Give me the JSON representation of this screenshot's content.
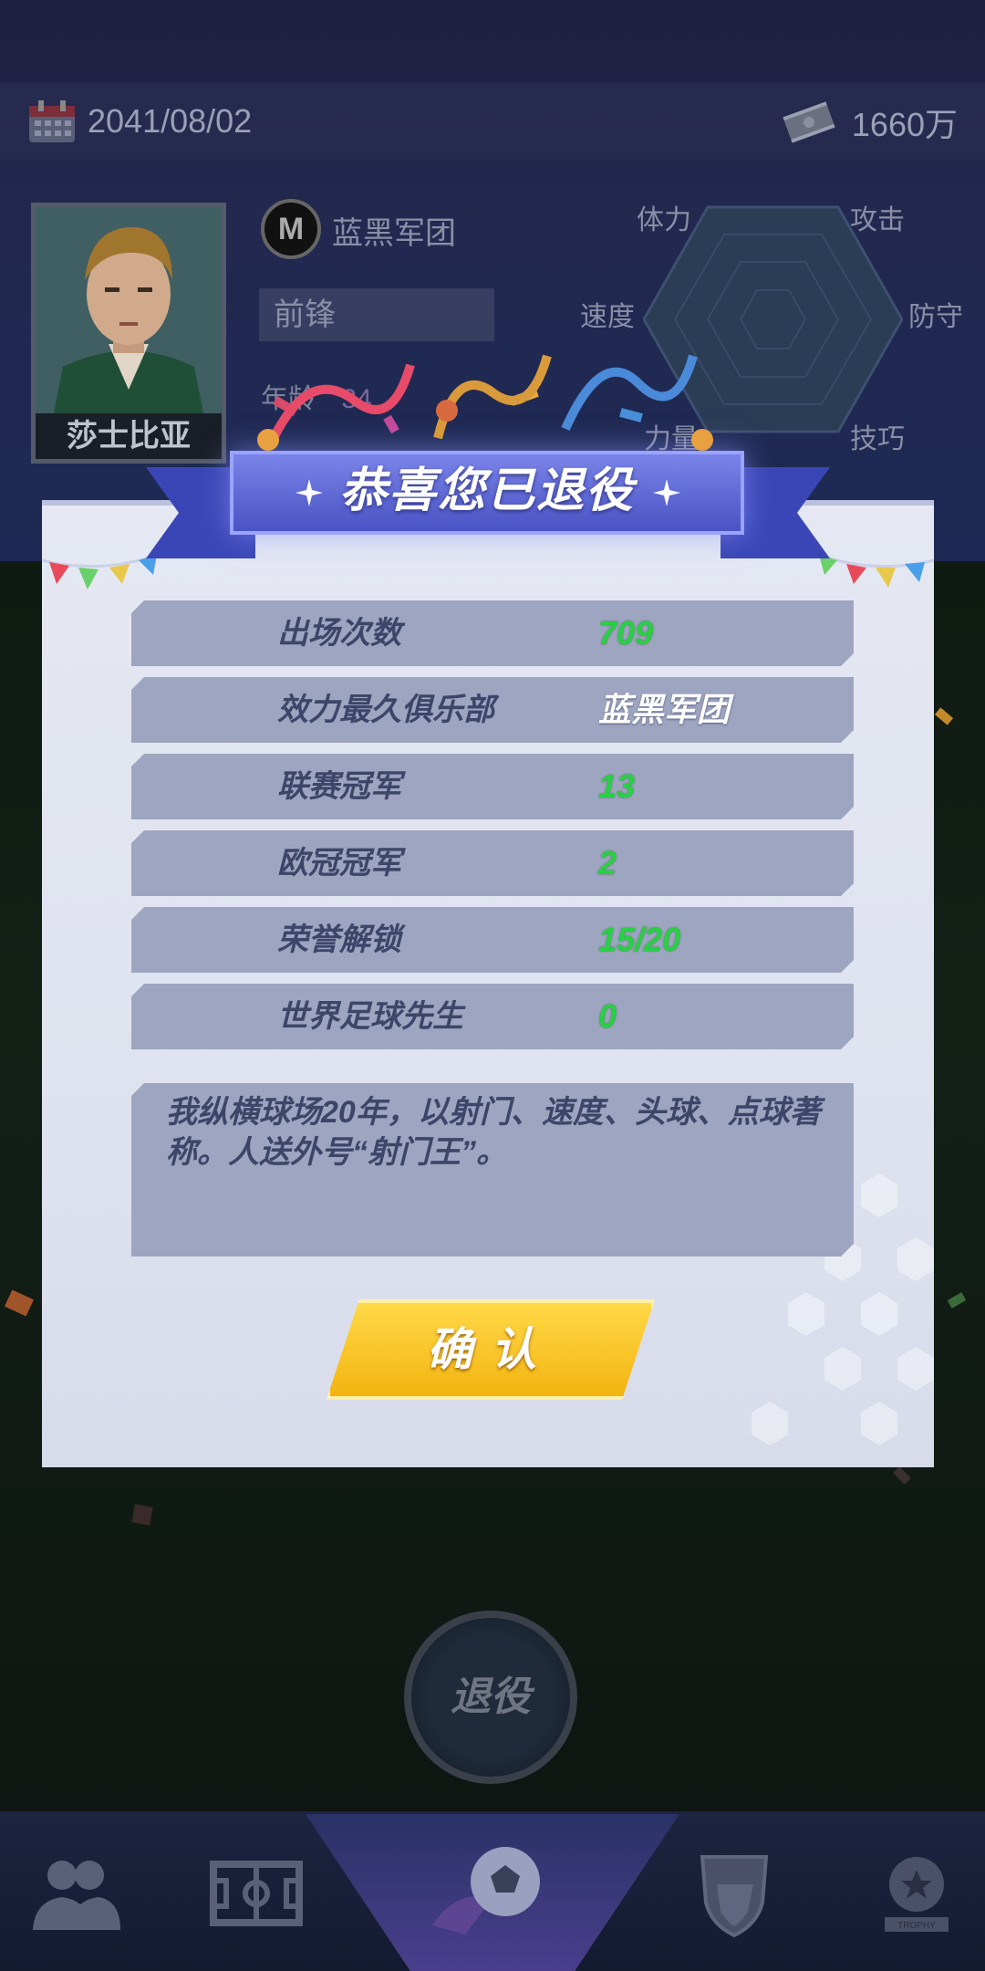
{
  "header": {
    "date": "2041/08/02",
    "money": "1660万"
  },
  "player": {
    "name": "莎士比亚",
    "club": "蓝黑军团",
    "club_logo_letter": "M",
    "position": "前锋",
    "age_label": "年龄",
    "age_value": "34"
  },
  "attributes": {
    "stamina": "体力",
    "attack": "攻击",
    "speed": "速度",
    "defense": "防守",
    "strength": "力量",
    "technique": "技巧"
  },
  "modal": {
    "title": "恭喜您已退役",
    "stats": [
      {
        "label": "出场次数",
        "value": "709"
      },
      {
        "label": "效力最久俱乐部",
        "value": "蓝黑军团"
      },
      {
        "label": "联赛冠军",
        "value": "13"
      },
      {
        "label": "欧冠冠军",
        "value": "2"
      },
      {
        "label": "荣誉解锁",
        "value": "15/20"
      },
      {
        "label": "世界足球先生",
        "value": "0"
      }
    ],
    "description": "我纵横球场20年，以射门、速度、头球、点球著称。人送外号“射门王”。",
    "confirm_label": "确认"
  },
  "retire_button": "退役",
  "nav": {
    "items": [
      "team-icon",
      "pitch-icon",
      "football-icon",
      "club-badge-icon",
      "trophy-icon"
    ],
    "trophy_text": "TROPHY"
  },
  "colors": {
    "accent_green": "#28d044",
    "banner_blue": "#4953c4",
    "confirm_yellow": "#f3b410"
  }
}
